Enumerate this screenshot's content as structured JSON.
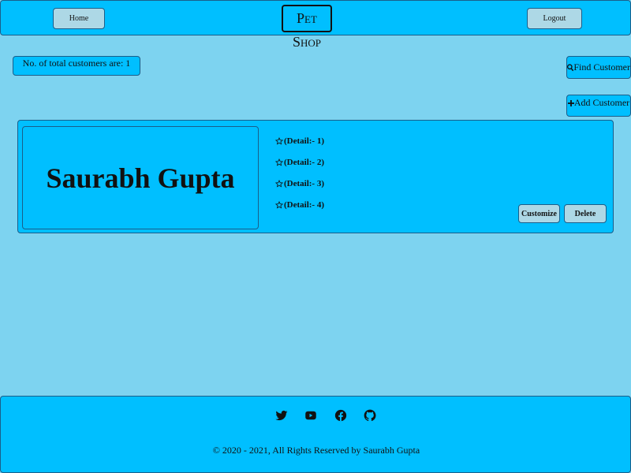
{
  "header": {
    "home_label": "Home",
    "logo_text": "Pet Shop",
    "logout_label": "Logout"
  },
  "summary": {
    "count_text": "No. of total customers are: 1"
  },
  "actions": {
    "find_label": "Find Customer",
    "add_label": "Add Customer"
  },
  "customers": [
    {
      "name": "Saurabh Gupta",
      "details": [
        "(Detail:- 1)",
        "(Detail:- 2)",
        "(Detail:- 3)",
        "(Detail:- 4)"
      ],
      "customize_label": "Customize",
      "delete_label": "Delete"
    }
  ],
  "footer": {
    "social_icons": [
      "twitter-icon",
      "youtube-icon",
      "facebook-icon",
      "github-icon"
    ],
    "copyright": "© 2020 - 2021, All Rights Reserved by Saurabh Gupta"
  },
  "colors": {
    "background": "#7dd3f0",
    "panel": "#00bfff",
    "button": "#add8e6",
    "border": "#1a5e8a"
  }
}
